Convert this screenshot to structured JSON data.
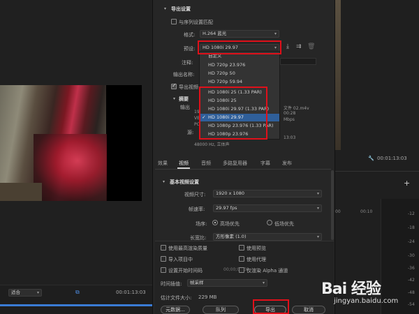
{
  "left": {
    "fit_select": "适合",
    "timecode": "00:01:13:03"
  },
  "export": {
    "section_title": "导出设置",
    "match_sequence": "与序列设置匹配",
    "format_label": "格式:",
    "format_value": "H.264 蓝光",
    "preset_label": "预设:",
    "preset_value": "HD 1080i 29.97",
    "comment_label": "注释:",
    "output_name_label": "输出名称:",
    "export_video_label": "导出视频",
    "summary_label": "摘要",
    "output_short": "输出",
    "source_short": "源:",
    "summary_lines": [
      "1920",
      "VBR",
      "PCM"
    ],
    "summary_right": [
      "文件 02.m4v",
      "00:28",
      "Mbps"
    ],
    "audio_line": "48000 Hz, 立体声",
    "time_line": "13:03"
  },
  "dropdown": {
    "items": [
      {
        "label": "自定义",
        "selected": false
      },
      {
        "label": "HD 720p 23.976",
        "selected": false
      },
      {
        "label": "HD 720p 50",
        "selected": false
      },
      {
        "label": "HD 720p 59.94",
        "selected": false
      },
      {
        "label": "HD 1080i 25 (1.33 PAR)",
        "selected": false
      },
      {
        "label": "HD 1080i 25",
        "selected": false
      },
      {
        "label": "HD 1080i 29.97 (1.33 PAR)",
        "selected": false
      },
      {
        "label": "HD 1080i 29.97",
        "selected": true
      },
      {
        "label": "HD 1080p 23.976 (1.33 PAR)",
        "selected": false
      },
      {
        "label": "HD 1080p 23.976",
        "selected": false
      }
    ]
  },
  "tabs": [
    "效果",
    "视频",
    "音频",
    "多路复用器",
    "字幕",
    "发布"
  ],
  "video": {
    "section_title": "基本视频设置",
    "frame_size_label": "视频尺寸:",
    "frame_size_value": "1920 x 1080",
    "frame_rate_label": "帧速率:",
    "frame_rate_value": "29.97 fps",
    "field_order_label": "场序:",
    "upper_first": "高场优先",
    "lower_first": "低场优先",
    "aspect_label": "长宽比:",
    "aspect_value": "方形像素 (1.0)"
  },
  "options": {
    "max_render_quality": "使用最高渲染质量",
    "use_preview": "使用预览",
    "import_into_project": "导入项目中",
    "use_proxy": "使用代理",
    "set_start_timecode": "设置开始时间码",
    "render_alpha_only": "仅渲染 Alpha 通道",
    "time_interp_label": "时间插值:",
    "time_interp_value": "帧采样",
    "est_size_label": "估计文件大小:",
    "est_size_value": "229 MB"
  },
  "buttons": {
    "metadata": "元数据...",
    "queue": "队列",
    "export": "导出",
    "cancel": "取消"
  },
  "right": {
    "timecode": "00:01:13:03",
    "ruler": [
      "00",
      "00:10"
    ],
    "db_labels": [
      "-12",
      "-18",
      "-24",
      "-30",
      "-36",
      "-42",
      "-48",
      "-54"
    ]
  },
  "watermark": {
    "logo": "Bai 经验",
    "url": "jingyan.baidu.com"
  },
  "colors": {
    "highlight_red": "#e0101a",
    "selection_blue": "#2f5f9a",
    "panel_bg": "#262626"
  }
}
